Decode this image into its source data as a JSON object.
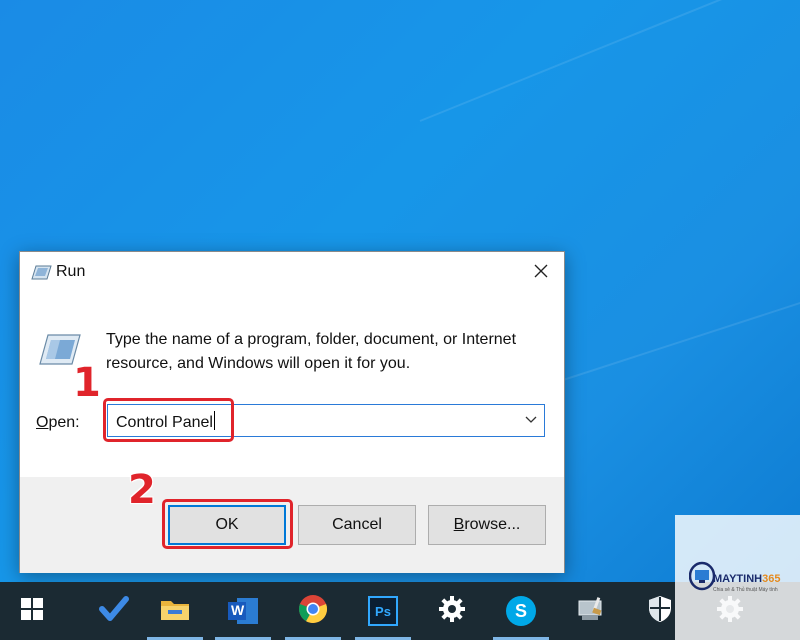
{
  "dialog": {
    "title": "Run",
    "description": "Type the name of a program, folder, document, or Internet resource, and Windows will open it for you.",
    "open_label_accesskey": "O",
    "open_label_rest": "pen:",
    "open_value": "Control Panel",
    "buttons": {
      "ok": "OK",
      "cancel": "Cancel",
      "browse_accesskey": "B",
      "browse_rest": "rowse..."
    }
  },
  "annotations": {
    "step1": "1",
    "step2": "2",
    "highlight_color": "#e0242b"
  },
  "taskbar": {
    "items": [
      {
        "icon": "windows-start-icon"
      },
      {
        "icon": "todo-check-icon"
      },
      {
        "icon": "file-explorer-icon"
      },
      {
        "icon": "word-icon",
        "label": "W"
      },
      {
        "icon": "chrome-icon"
      },
      {
        "icon": "photoshop-icon",
        "label": "Ps"
      },
      {
        "icon": "settings-gear-icon"
      },
      {
        "icon": "skype-icon",
        "label": "S"
      },
      {
        "icon": "disk-cleanup-icon"
      },
      {
        "icon": "security-shield-icon"
      },
      {
        "icon": "settings-gear-icon-2"
      }
    ]
  },
  "watermark": {
    "brand_main": "MAYTINH",
    "brand_accent": "365",
    "tagline": "Chia sẻ & Thủ thuật Máy tính"
  },
  "colors": {
    "accent_blue": "#0078d7",
    "taskbar": "#1b2a33",
    "desktop": "#1a8be6"
  }
}
